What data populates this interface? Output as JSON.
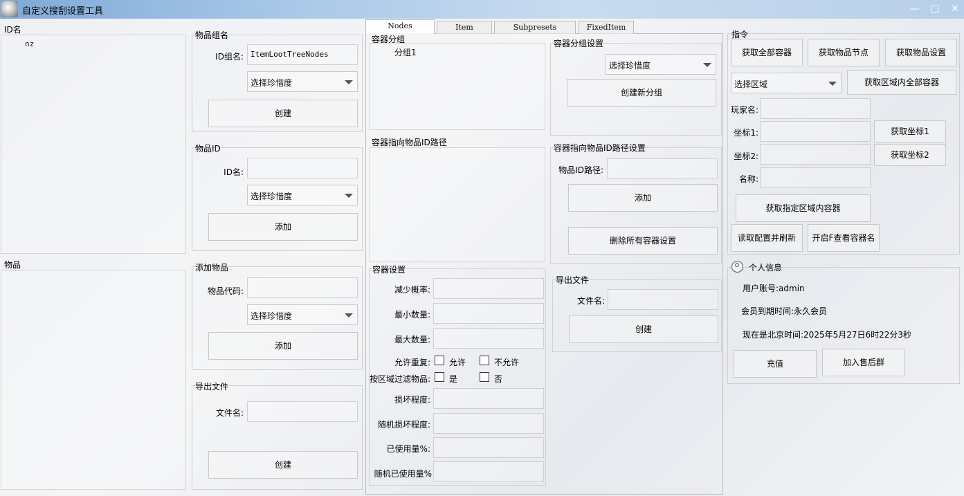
{
  "window": {
    "title": "自定义搜刮设置工具",
    "min": "—",
    "max": "□",
    "close": "✕"
  },
  "left": {
    "idname_header": "ID名",
    "idname_items": [
      "nz"
    ],
    "items_header": "物品"
  },
  "item_group": {
    "title": "物品组名",
    "id_label": "ID组名:",
    "id_value": "ItemLootTreeNodes",
    "rarity": "选择珍惜度",
    "create": "创建"
  },
  "item_id": {
    "title": "物品ID",
    "id_label": "ID名:",
    "id_value": "",
    "rarity": "选择珍惜度",
    "add": "添加"
  },
  "add_item": {
    "title": "添加物品",
    "code_label": "物品代码:",
    "code_value": "",
    "rarity": "选择珍惜度",
    "add": "添加"
  },
  "export_left": {
    "title": "导出文件",
    "file_label": "文件名:",
    "file_value": "",
    "create": "创建"
  },
  "tabs": [
    "Nodes",
    "Item",
    "Subpresets",
    "FixedItem"
  ],
  "container_group": {
    "title": "容器分组",
    "items": [
      "分组1"
    ]
  },
  "container_path": {
    "title": "容器指向物品ID路径"
  },
  "container_group_settings": {
    "title": "容器分组设置",
    "rarity": "选择珍惜度",
    "create": "创建新分组"
  },
  "path_settings": {
    "title": "容器指向物品ID路径设置",
    "path_label": "物品ID路径:",
    "path_value": "",
    "add": "添加",
    "delete_all": "删除所有容器设置"
  },
  "container_settings": {
    "title": "容器设置",
    "fields": [
      {
        "label": "减少概率:",
        "value": ""
      },
      {
        "label": "最小数量:",
        "value": ""
      },
      {
        "label": "最大数量:",
        "value": ""
      }
    ],
    "allow_repeat_label": "允许重复:",
    "allow": "允许",
    "disallow": "不允许",
    "filter_label": "按区域过滤物品:",
    "yes": "是",
    "no": "否",
    "fields2": [
      {
        "label": "损坏程度:",
        "value": ""
      },
      {
        "label": "随机损坏程度:",
        "value": ""
      },
      {
        "label": "已使用量%:",
        "value": ""
      },
      {
        "label": "随机已使用量%",
        "value": ""
      }
    ]
  },
  "export_mid": {
    "title": "导出文件",
    "file_label": "文件名:",
    "file_value": "",
    "create": "创建"
  },
  "commands": {
    "title": "指令",
    "get_all_containers": "获取全部容器",
    "get_item_nodes": "获取物品节点",
    "get_item_settings": "获取物品设置",
    "select_area": "选择区域",
    "get_area_containers": "获取区域内全部容器",
    "player_label": "玩家名:",
    "coord1_label": "坐标1:",
    "coord2_label": "坐标2:",
    "name_label": "名称:",
    "get_coord1": "获取坐标1",
    "get_coord2": "获取坐标2",
    "get_specified": "获取指定区域内容器",
    "read_refresh": "读取配置并刷新",
    "open_f": "开启F查看容器名"
  },
  "profile": {
    "title": "个人信息",
    "account": "用户账号:admin",
    "expire": "会员到期时间:永久会员",
    "time": "现在是北京时间:2025年5月27日6时22分3秒",
    "recharge": "充值",
    "join": "加入售后群"
  }
}
